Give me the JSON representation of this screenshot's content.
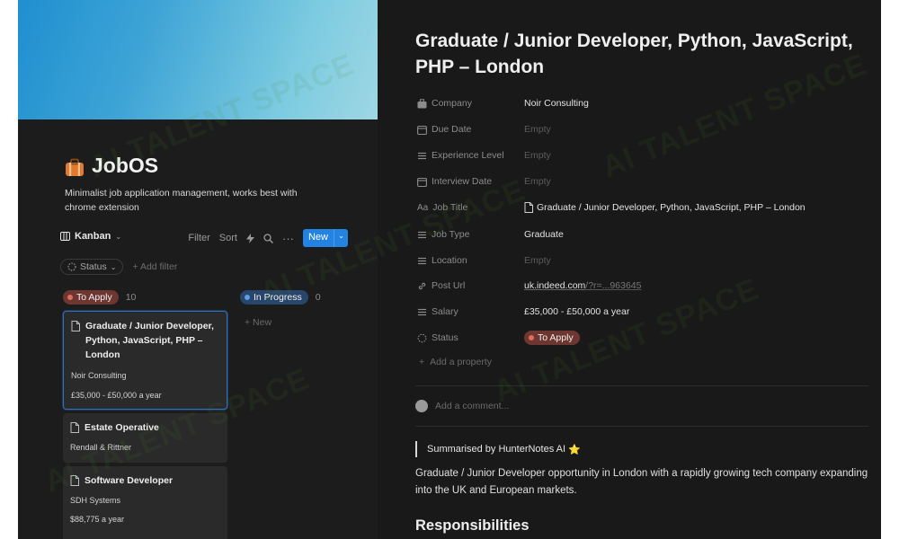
{
  "workspace": {
    "title": "JobOS",
    "description": "Minimalist job application management, works best with chrome extension",
    "view": {
      "label": "Kanban"
    },
    "toolbar": {
      "filter": "Filter",
      "sort": "Sort",
      "new_label": "New"
    },
    "status_filter": "Status",
    "add_filter": "+ Add filter",
    "columns": [
      {
        "label": "To Apply",
        "count": "10",
        "color": "#6e3630"
      },
      {
        "label": "In Progress",
        "count": "0",
        "color": "#28456c",
        "new_item": "+ New"
      }
    ],
    "cards": [
      {
        "title": "Graduate / Junior Developer, Python, JavaScript, PHP – London",
        "company": "Noir Consulting",
        "salary": "£35,000 - £50,000 a year"
      },
      {
        "title": "Estate Operative",
        "company": "Rendall & Rittner"
      },
      {
        "title": "Software Developer",
        "company": "SDH Systems",
        "salary": "$88,775 a year"
      }
    ]
  },
  "detail": {
    "title": "Graduate / Junior Developer, Python, JavaScript, PHP – London",
    "properties": [
      {
        "name": "Company",
        "icon": "briefcase-icon",
        "value": "Noir Consulting"
      },
      {
        "name": "Due Date",
        "icon": "calendar-icon",
        "value": "Empty"
      },
      {
        "name": "Experience Level",
        "icon": "list-icon",
        "value": "Empty"
      },
      {
        "name": "Interview Date",
        "icon": "calendar-icon",
        "value": "Empty"
      },
      {
        "name": "Job Title",
        "icon": "text-icon",
        "value": "Graduate / Junior Developer, Python, JavaScript, PHP – London"
      },
      {
        "name": "Job Type",
        "icon": "list-icon",
        "value": "Graduate"
      },
      {
        "name": "Location",
        "icon": "list-icon",
        "value": "Empty"
      },
      {
        "name": "Post Url",
        "icon": "link-icon",
        "value_link": "uk.indeed.com",
        "value_rest": "/?r=...963645"
      },
      {
        "name": "Salary",
        "icon": "list-icon",
        "value": "£35,000 - £50,000 a year"
      },
      {
        "name": "Status",
        "icon": "status-icon",
        "value": "To Apply"
      }
    ],
    "text_icon_label": "Aa",
    "add_property": "Add a property",
    "comment_placeholder": "Add a comment...",
    "summary_label": "Summarised by HunterNotes AI",
    "summary_star": "⭐",
    "summary": "Graduate / Junior Developer opportunity in London with a rapidly growing tech company expanding into the UK and European markets.",
    "section_heading": "Responsibilities"
  },
  "watermark": "AI TALENT SPACE",
  "colors": {
    "accent": "#2383e2",
    "to_apply": "#e06c5c",
    "in_progress": "#5aa0e6"
  }
}
